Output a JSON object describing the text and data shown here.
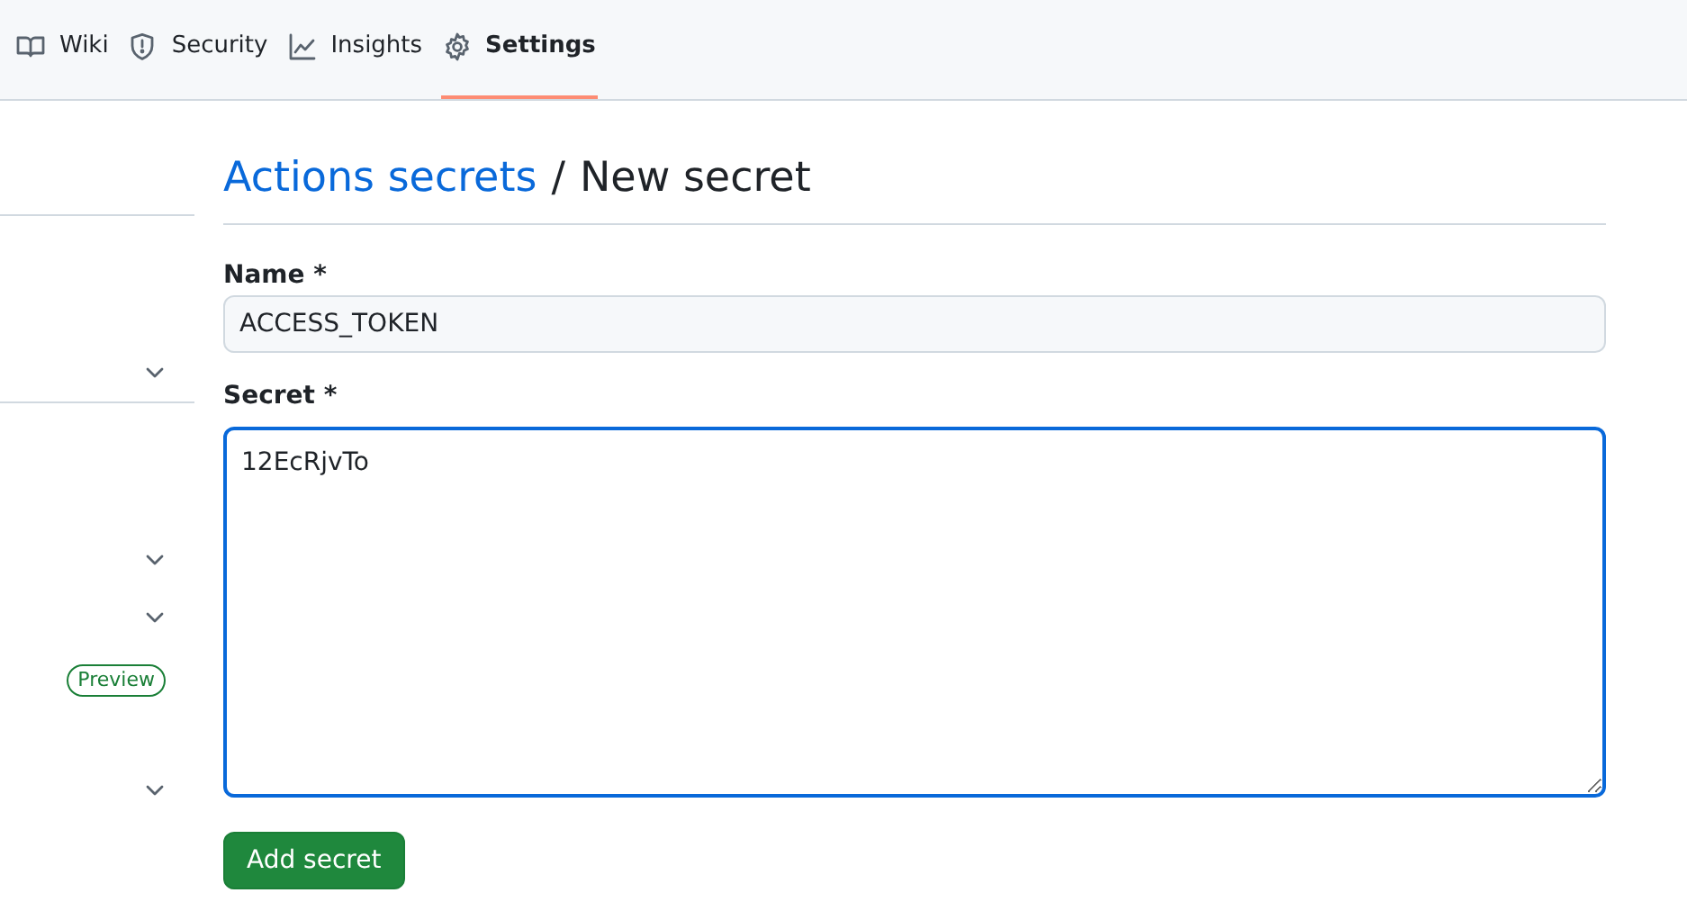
{
  "tabs": [
    {
      "label": "Wiki",
      "selected": false
    },
    {
      "label": "Security",
      "selected": false
    },
    {
      "label": "Insights",
      "selected": false
    },
    {
      "label": "Settings",
      "selected": true
    }
  ],
  "sidebar": {
    "groups": [
      {
        "items": [
          {
            "kind": "chevron",
            "expanded": false
          }
        ]
      },
      {
        "items": [
          {
            "kind": "chevron",
            "expanded": false
          },
          {
            "kind": "chevron",
            "expanded": false
          },
          {
            "kind": "badge",
            "label": "Preview"
          },
          {
            "kind": "chevron",
            "expanded": false
          }
        ]
      }
    ]
  },
  "breadcrumb": {
    "link": "Actions secrets",
    "separator": "/",
    "current": "New secret"
  },
  "form": {
    "name_label": "Name *",
    "name_value": "ACCESS_TOKEN",
    "secret_label": "Secret *",
    "secret_value": "12EcRjvTo",
    "secret_focused": true,
    "submit": "Add secret"
  }
}
